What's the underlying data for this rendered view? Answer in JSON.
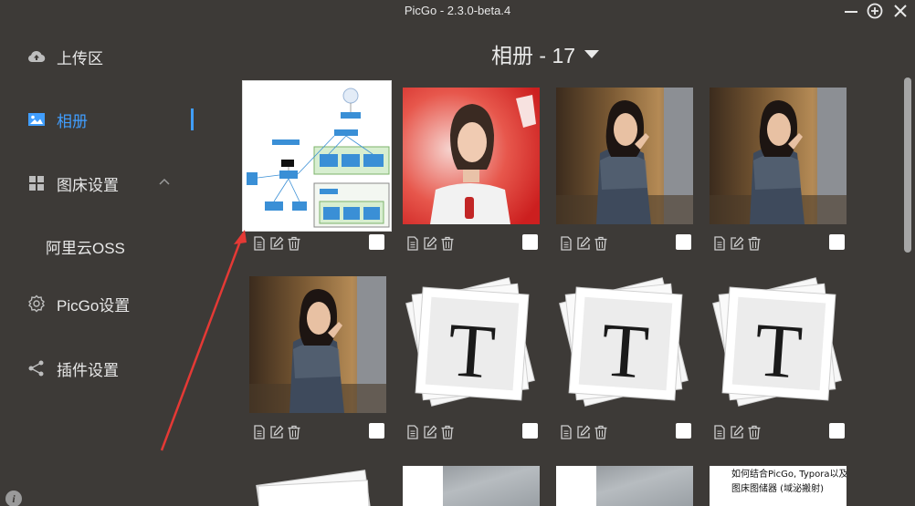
{
  "window": {
    "title": "PicGo - 2.3.0-beta.4",
    "controls": [
      "minimize-icon",
      "maximize-icon",
      "close-icon"
    ]
  },
  "sidebar": {
    "items": [
      {
        "label": "上传区",
        "icon": "cloud-upload-icon"
      },
      {
        "label": "相册",
        "icon": "image-icon",
        "active": true
      },
      {
        "label": "图床设置",
        "icon": "grid-icon",
        "expanded": true
      },
      {
        "label": "阿里云OSS",
        "icon": ""
      },
      {
        "label": "PicGo设置",
        "icon": "gear-icon"
      },
      {
        "label": "插件设置",
        "icon": "share-icon"
      }
    ],
    "info_label": "i"
  },
  "album": {
    "title": "相册 - 17"
  },
  "gallery": {
    "items": [
      {
        "kind": "diagram"
      },
      {
        "kind": "photo-red"
      },
      {
        "kind": "photo-elevator"
      },
      {
        "kind": "photo-elevator"
      },
      {
        "kind": "photo-elevator"
      },
      {
        "kind": "typora-logo",
        "glyph": "T"
      },
      {
        "kind": "typora-logo",
        "glyph": "T"
      },
      {
        "kind": "typora-logo",
        "glyph": "T"
      },
      {
        "kind": "typora-partial"
      },
      {
        "kind": "gray-partial"
      },
      {
        "kind": "gray-partial"
      },
      {
        "kind": "text-partial",
        "text_line1": "如何结合PicGo, Typora以及阿里云对",
        "text_line2": "图床图储器 (域泌搬射)"
      }
    ]
  },
  "colors": {
    "background": "#3d3a37",
    "accent": "#409eff",
    "annotation_arrow": "#e53935"
  }
}
